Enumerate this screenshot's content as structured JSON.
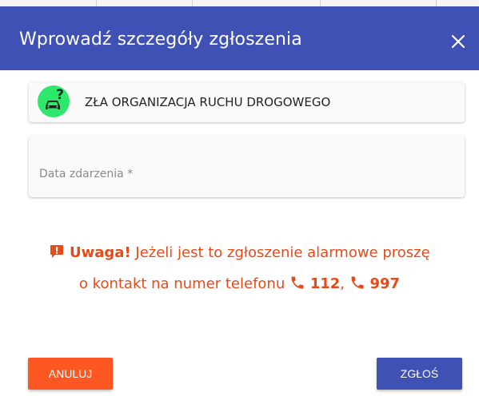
{
  "dialog": {
    "title": "Wprowadź szczegóły zgłoszenia",
    "close_icon": "close-icon",
    "header_color": "#3f51b5"
  },
  "category": {
    "label": "ZŁA ORGANIZACJA RUCHU DROGOWEGO",
    "icon": "car-question-icon",
    "icon_color": "#2ee86b"
  },
  "date_field": {
    "placeholder": "Data zdarzenia *"
  },
  "warning": {
    "icon": "alert-icon",
    "bold_prefix": "Uwaga!",
    "text_1": "Jeżeli jest to zgłoszenie alarmowe proszę",
    "text_2": "o kontakt na numer telefonu",
    "phone_icon": "phone-icon",
    "number_1": "112",
    "separator": ",",
    "number_2": "997",
    "color": "#e64a19"
  },
  "buttons": {
    "cancel": "ANULUJ",
    "submit": "ZGŁOŚ",
    "cancel_color": "#ff5722",
    "submit_color": "#3f51b5"
  }
}
